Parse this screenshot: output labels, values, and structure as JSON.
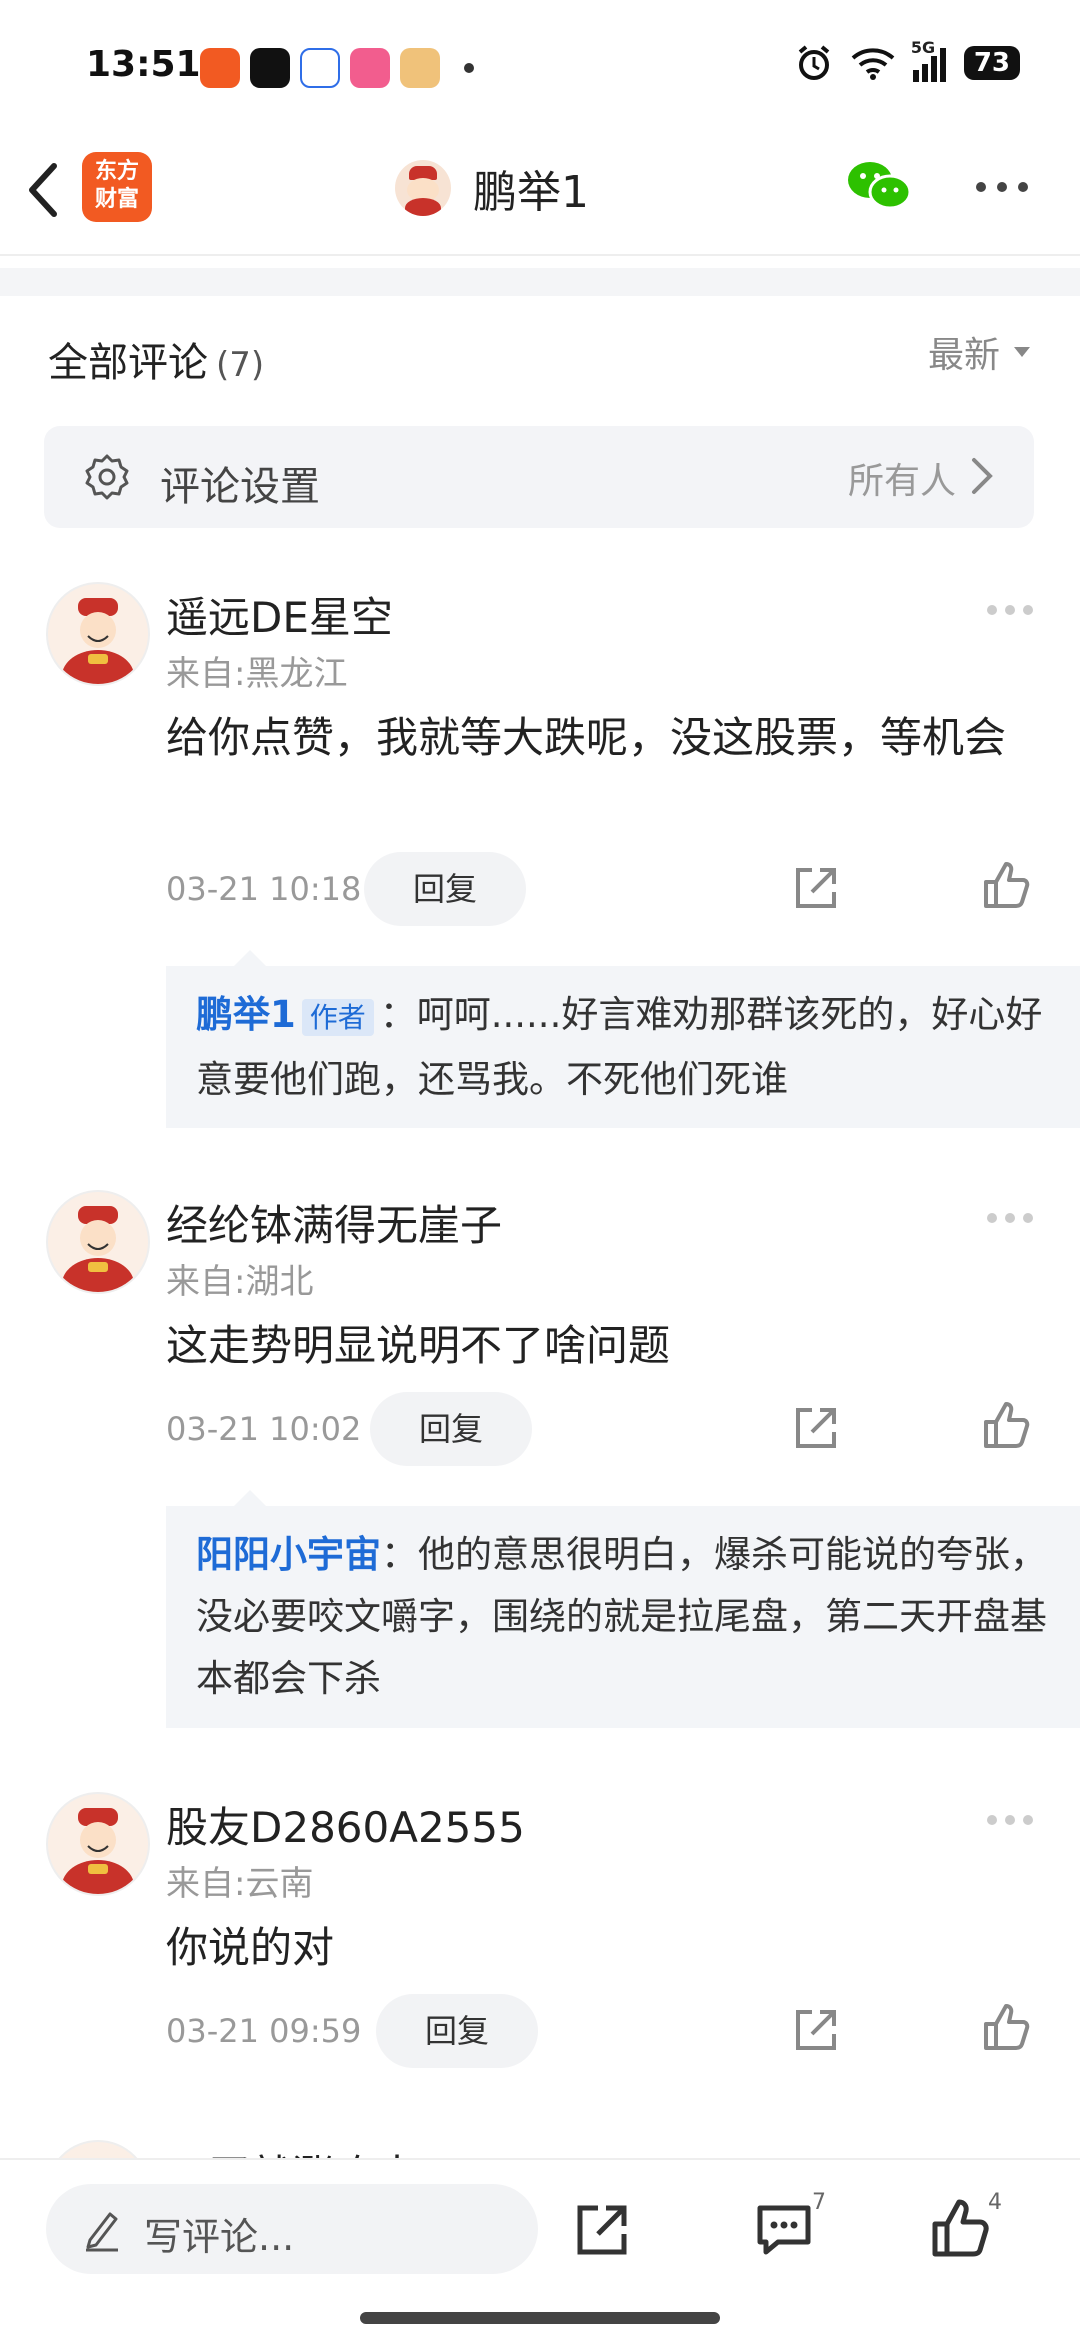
{
  "status_bar": {
    "time": "13:51",
    "battery": "73",
    "network": "5G"
  },
  "header": {
    "logo_line1": "东方",
    "logo_line2": "财富",
    "title": "鹏举1"
  },
  "comments_section": {
    "title": "全部评论",
    "count": "(7)",
    "sort_label": "最新",
    "settings_label": "评论设置",
    "settings_value": "所有人"
  },
  "comments": [
    {
      "name": "遥远DE星空",
      "location": "来自:黑龙江",
      "text": "给你点赞，我就等大跌呢，没这股票，等机会",
      "time": "03-21 10:18",
      "reply_label": "回复",
      "sub_reply": {
        "author": "鹏举1",
        "tag": "作者",
        "text": "：呵呵......好言难劝那群该死的，好心好意要他们跑，还骂我。不死他们死谁"
      }
    },
    {
      "name": "经纶钵满得无崖子",
      "location": "来自:湖北",
      "text": "这走势明显说明不了啥问题",
      "time": "03-21 10:02",
      "reply_label": "回复",
      "sub_reply": {
        "author": "阳阳小宇宙",
        "tag": "",
        "text": "：他的意思很明白，爆杀可能说的夸张，没必要咬文嚼字，围绕的就是拉尾盘，第二天开盘基本都会下杀"
      }
    },
    {
      "name": "股友D2860A2555",
      "location": "来自:云南",
      "text": "你说的对",
      "time": "03-21 09:59",
      "reply_label": "回复"
    }
  ],
  "partial_next_name": "一买就涨吃大",
  "bottom_bar": {
    "write_placeholder": "写评论...",
    "comment_count": "7",
    "like_count": "4"
  }
}
